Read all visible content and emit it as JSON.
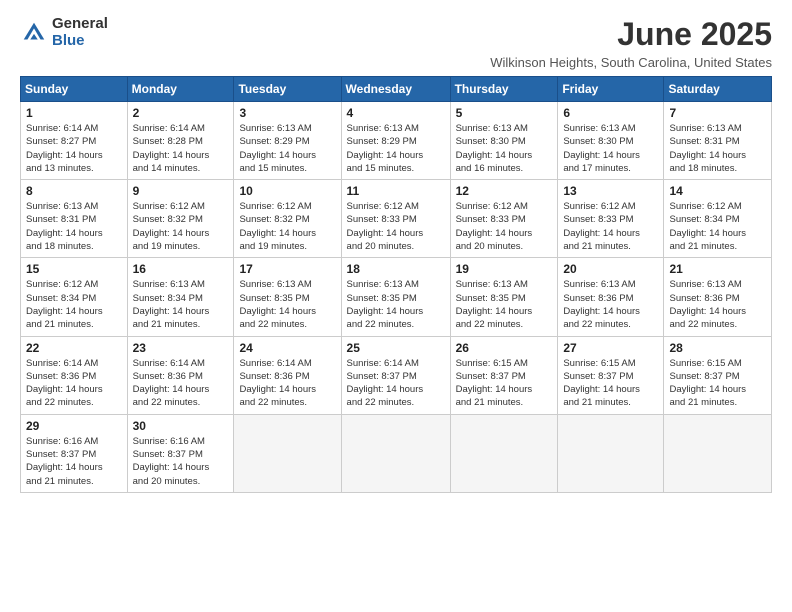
{
  "header": {
    "logo_general": "General",
    "logo_blue": "Blue",
    "month_title": "June 2025",
    "location": "Wilkinson Heights, South Carolina, United States"
  },
  "days_of_week": [
    "Sunday",
    "Monday",
    "Tuesday",
    "Wednesday",
    "Thursday",
    "Friday",
    "Saturday"
  ],
  "weeks": [
    [
      {
        "day": "1",
        "info": "Sunrise: 6:14 AM\nSunset: 8:27 PM\nDaylight: 14 hours\nand 13 minutes."
      },
      {
        "day": "2",
        "info": "Sunrise: 6:14 AM\nSunset: 8:28 PM\nDaylight: 14 hours\nand 14 minutes."
      },
      {
        "day": "3",
        "info": "Sunrise: 6:13 AM\nSunset: 8:29 PM\nDaylight: 14 hours\nand 15 minutes."
      },
      {
        "day": "4",
        "info": "Sunrise: 6:13 AM\nSunset: 8:29 PM\nDaylight: 14 hours\nand 15 minutes."
      },
      {
        "day": "5",
        "info": "Sunrise: 6:13 AM\nSunset: 8:30 PM\nDaylight: 14 hours\nand 16 minutes."
      },
      {
        "day": "6",
        "info": "Sunrise: 6:13 AM\nSunset: 8:30 PM\nDaylight: 14 hours\nand 17 minutes."
      },
      {
        "day": "7",
        "info": "Sunrise: 6:13 AM\nSunset: 8:31 PM\nDaylight: 14 hours\nand 18 minutes."
      }
    ],
    [
      {
        "day": "8",
        "info": "Sunrise: 6:13 AM\nSunset: 8:31 PM\nDaylight: 14 hours\nand 18 minutes."
      },
      {
        "day": "9",
        "info": "Sunrise: 6:12 AM\nSunset: 8:32 PM\nDaylight: 14 hours\nand 19 minutes."
      },
      {
        "day": "10",
        "info": "Sunrise: 6:12 AM\nSunset: 8:32 PM\nDaylight: 14 hours\nand 19 minutes."
      },
      {
        "day": "11",
        "info": "Sunrise: 6:12 AM\nSunset: 8:33 PM\nDaylight: 14 hours\nand 20 minutes."
      },
      {
        "day": "12",
        "info": "Sunrise: 6:12 AM\nSunset: 8:33 PM\nDaylight: 14 hours\nand 20 minutes."
      },
      {
        "day": "13",
        "info": "Sunrise: 6:12 AM\nSunset: 8:33 PM\nDaylight: 14 hours\nand 21 minutes."
      },
      {
        "day": "14",
        "info": "Sunrise: 6:12 AM\nSunset: 8:34 PM\nDaylight: 14 hours\nand 21 minutes."
      }
    ],
    [
      {
        "day": "15",
        "info": "Sunrise: 6:12 AM\nSunset: 8:34 PM\nDaylight: 14 hours\nand 21 minutes."
      },
      {
        "day": "16",
        "info": "Sunrise: 6:13 AM\nSunset: 8:34 PM\nDaylight: 14 hours\nand 21 minutes."
      },
      {
        "day": "17",
        "info": "Sunrise: 6:13 AM\nSunset: 8:35 PM\nDaylight: 14 hours\nand 22 minutes."
      },
      {
        "day": "18",
        "info": "Sunrise: 6:13 AM\nSunset: 8:35 PM\nDaylight: 14 hours\nand 22 minutes."
      },
      {
        "day": "19",
        "info": "Sunrise: 6:13 AM\nSunset: 8:35 PM\nDaylight: 14 hours\nand 22 minutes."
      },
      {
        "day": "20",
        "info": "Sunrise: 6:13 AM\nSunset: 8:36 PM\nDaylight: 14 hours\nand 22 minutes."
      },
      {
        "day": "21",
        "info": "Sunrise: 6:13 AM\nSunset: 8:36 PM\nDaylight: 14 hours\nand 22 minutes."
      }
    ],
    [
      {
        "day": "22",
        "info": "Sunrise: 6:14 AM\nSunset: 8:36 PM\nDaylight: 14 hours\nand 22 minutes."
      },
      {
        "day": "23",
        "info": "Sunrise: 6:14 AM\nSunset: 8:36 PM\nDaylight: 14 hours\nand 22 minutes."
      },
      {
        "day": "24",
        "info": "Sunrise: 6:14 AM\nSunset: 8:36 PM\nDaylight: 14 hours\nand 22 minutes."
      },
      {
        "day": "25",
        "info": "Sunrise: 6:14 AM\nSunset: 8:37 PM\nDaylight: 14 hours\nand 22 minutes."
      },
      {
        "day": "26",
        "info": "Sunrise: 6:15 AM\nSunset: 8:37 PM\nDaylight: 14 hours\nand 21 minutes."
      },
      {
        "day": "27",
        "info": "Sunrise: 6:15 AM\nSunset: 8:37 PM\nDaylight: 14 hours\nand 21 minutes."
      },
      {
        "day": "28",
        "info": "Sunrise: 6:15 AM\nSunset: 8:37 PM\nDaylight: 14 hours\nand 21 minutes."
      }
    ],
    [
      {
        "day": "29",
        "info": "Sunrise: 6:16 AM\nSunset: 8:37 PM\nDaylight: 14 hours\nand 21 minutes."
      },
      {
        "day": "30",
        "info": "Sunrise: 6:16 AM\nSunset: 8:37 PM\nDaylight: 14 hours\nand 20 minutes."
      },
      {
        "day": "",
        "info": ""
      },
      {
        "day": "",
        "info": ""
      },
      {
        "day": "",
        "info": ""
      },
      {
        "day": "",
        "info": ""
      },
      {
        "day": "",
        "info": ""
      }
    ]
  ]
}
